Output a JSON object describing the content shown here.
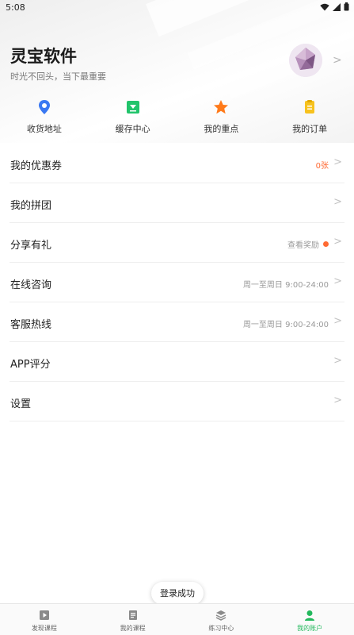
{
  "status_bar": {
    "time": "5:08"
  },
  "profile": {
    "name": "灵宝软件",
    "motto": "时光不回头，当下最重要"
  },
  "quick_actions": [
    {
      "label": "收货地址",
      "icon": "location-pin-icon",
      "color": "#3a78f2"
    },
    {
      "label": "缓存中心",
      "icon": "download-icon",
      "color": "#22c46b"
    },
    {
      "label": "我的重点",
      "icon": "star-icon",
      "color": "#ff7a1a"
    },
    {
      "label": "我的订单",
      "icon": "order-icon",
      "color": "#f7c21e"
    }
  ],
  "menu": [
    {
      "label": "我的优惠券",
      "right": "0张",
      "right_color": "#ff6a33"
    },
    {
      "label": "我的拼团",
      "right": ""
    },
    {
      "label": "分享有礼",
      "right": "查看奖励",
      "dot": true
    },
    {
      "label": "在线咨询",
      "right": "周一至周日 9:00-24:00"
    },
    {
      "label": "客服热线",
      "right": "周一至周日 9:00-24:00"
    },
    {
      "label": "APP评分",
      "right": ""
    },
    {
      "label": "设置",
      "right": ""
    }
  ],
  "toast": {
    "text": "登录成功"
  },
  "tabbar": [
    {
      "label": "发现课程",
      "icon": "video-icon",
      "active": false
    },
    {
      "label": "我的课程",
      "icon": "book-icon",
      "active": false
    },
    {
      "label": "练习中心",
      "icon": "layers-icon",
      "active": false
    },
    {
      "label": "我的账户",
      "icon": "user-icon",
      "active": true
    }
  ],
  "colors": {
    "accent": "#22b85c",
    "highlight": "#ff6a33"
  }
}
